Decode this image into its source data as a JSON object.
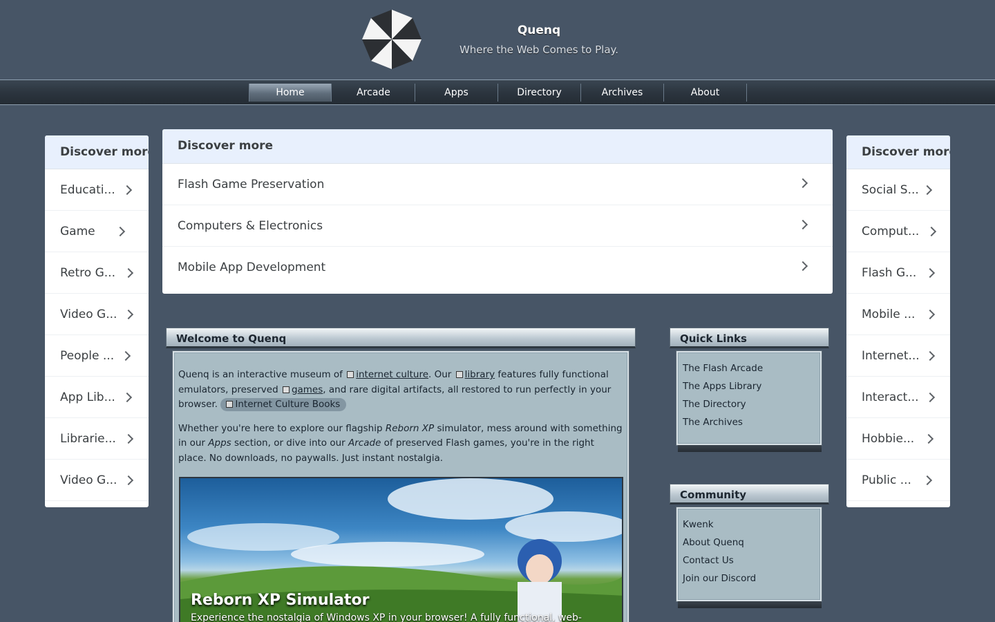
{
  "header": {
    "site_name": "Quenq",
    "tagline": "Where the Web Comes to Play."
  },
  "nav": {
    "items": [
      {
        "label": "Home",
        "active": true
      },
      {
        "label": "Arcade"
      },
      {
        "label": "Apps"
      },
      {
        "label": "Directory"
      },
      {
        "label": "Archives"
      },
      {
        "label": "About"
      }
    ]
  },
  "left_discover": {
    "heading": "Discover more",
    "items": [
      "Educati...",
      "Game",
      "Retro G...",
      "Video G...",
      "People ...",
      "App Lib...",
      "Librarie...",
      "Video G..."
    ]
  },
  "center_discover": {
    "heading": "Discover more",
    "items": [
      "Flash Game Preservation",
      "Computers & Electronics",
      "Mobile App Development"
    ]
  },
  "right_discover": {
    "heading": "Discover more",
    "items": [
      "Social S...",
      "Comput...",
      "Flash G...",
      "Mobile ...",
      "Internet...",
      "Interact...",
      "Hobbie...",
      "Public ..."
    ]
  },
  "welcome": {
    "title": "Welcome to Quenq",
    "p1_a": "Quenq is an interactive museum of",
    "p1_link1": "internet culture",
    "p1_b": ". Our",
    "p1_link2": "library",
    "p1_c": "features fully functional emulators, preserved",
    "p1_link3": "games",
    "p1_d": ", and rare digital artifacts, all restored to run perfectly in your browser.",
    "p1_pill": "Internet Culture Books",
    "p2_a": "Whether you're here to explore our flagship",
    "p2_em1": "Reborn XP",
    "p2_b": "simulator, mess around with something in our",
    "p2_em2": "Apps",
    "p2_c": "section, or dive into our",
    "p2_em3": "Arcade",
    "p2_d": "of preserved Flash games, you're in the right place. No downloads, no paywalls. Just instant nostalgia."
  },
  "hero": {
    "title": "Reborn XP Simulator",
    "description": "Experience the nostalgia of Windows XP in your browser! A fully functional, web-"
  },
  "quick_links": {
    "title": "Quick Links",
    "items": [
      "The Flash Arcade",
      "The Apps Library",
      "The Directory",
      "The Archives"
    ]
  },
  "community": {
    "title": "Community",
    "items": [
      "Kwenk",
      "About Quenq",
      "Contact Us",
      "Join our Discord"
    ]
  },
  "colors": {
    "page_bg": "#475566",
    "card_head": "#e8f0fd",
    "panel_body": "#a9bcc4"
  }
}
